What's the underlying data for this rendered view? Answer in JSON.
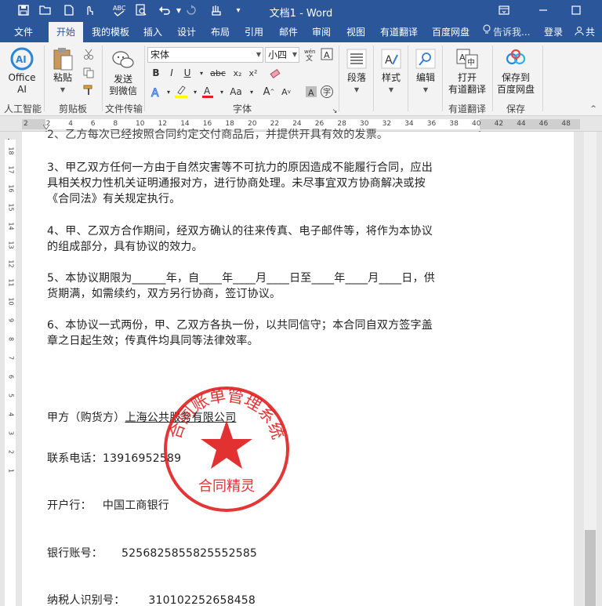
{
  "window": {
    "title": "文档1 - Word",
    "qat_icons": [
      "save-icon",
      "open-icon",
      "new-icon",
      "touch-mode-icon",
      "spelling-icon",
      "print-preview-icon",
      "undo-icon",
      "redo-icon",
      "customize-icon"
    ]
  },
  "tabs": {
    "file": "文件",
    "home": "开始",
    "template": "我的模板",
    "insert": "插入",
    "design": "设计",
    "layout": "布局",
    "references": "引用",
    "mailings": "邮件",
    "review": "审阅",
    "view": "视图",
    "youdao": "有道翻译",
    "baidu": "百度网盘",
    "tell_me": "告诉我...",
    "login": "登录",
    "share": "共"
  },
  "ribbon": {
    "office_ai_line1": "Office",
    "office_ai_line2": "AI",
    "paste": "粘贴",
    "send_line1": "发送",
    "send_line2": "到微信",
    "font_name": "宋体",
    "font_size": "小四",
    "paragraph": "段落",
    "styles": "样式",
    "editing": "编辑",
    "open_translate_line1": "打开",
    "open_translate_line2": "有道翻译",
    "save_baidu_line1": "保存到",
    "save_baidu_line2": "百度网盘",
    "group_ai": "人工智能",
    "group_clipboard": "剪贴板",
    "group_wechat": "文件传输",
    "group_font": "字体",
    "group_translate": "有道翻译",
    "group_save": "保存"
  },
  "ruler": {
    "h_marks": [
      "2",
      "2",
      "4",
      "6",
      "8",
      "10",
      "12",
      "14",
      "16",
      "18",
      "20",
      "22",
      "24",
      "26",
      "28",
      "30",
      "32",
      "34",
      "36",
      "38",
      "40",
      "42",
      "44",
      "46",
      "48"
    ],
    "v_marks": [
      "18",
      "17",
      "16",
      "15",
      "14",
      "13",
      "12",
      "11",
      "10",
      "9",
      "8",
      "7",
      "6",
      "5",
      "4",
      "3",
      "2",
      "1"
    ]
  },
  "document": {
    "cut_line": "2、乙方每次已经按照合同约定交付商品后，并提供开具有效的发票。",
    "p3_l1": "3、甲乙双方任何一方由于自然灾害等不可抗力的原因造成不能履行合同，应出",
    "p3_l2": "具相关权力性机关证明通报对方，进行协商处理。未尽事宜双方协商解决或按",
    "p3_l3": "《合同法》有关规定执行。",
    "p4_l1": "4、甲、乙双方合作期间，经双方确认的往来传真、电子邮件等，将作为本协议",
    "p4_l2": "的组成部分，具有协议的效力。",
    "p5_l1": "5、本协议期限为______年，自____年____月____日至____年____月____日，供",
    "p5_l2": "货期满，如需续约，双方另行协商，签订协议。",
    "p6_l1": "6、本协议一式两份，甲、乙双方各执一份，以共同信守；本合同自双方签字盖",
    "p6_l2": "章之日起生效；传真件均具同等法律效率。",
    "party_a_label": "甲方（购货方）",
    "party_a_name": "上海公共服务有限公司",
    "phone_label": "联系电话：",
    "phone_value": "13916952589",
    "bank_label": "开户行：",
    "bank_value": "中国工商银行",
    "account_label": "银行账号：",
    "account_value": "5256825855825552585",
    "tax_label": "纳税人识别号：",
    "tax_value": "310102252658458"
  },
  "stamp": {
    "arc_text": "合同账单管理系统",
    "bottom_text": "合同精灵",
    "color": "#e02020"
  }
}
